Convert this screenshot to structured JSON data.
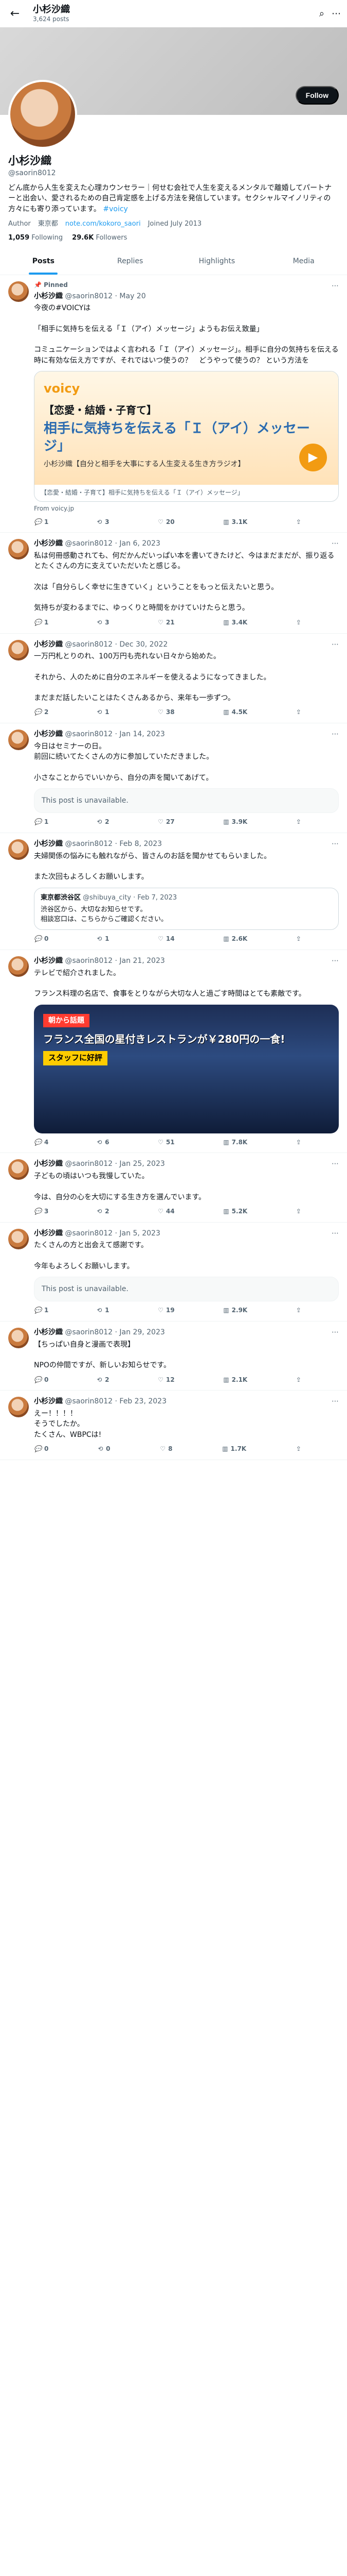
{
  "topbar": {
    "name": "小杉沙織",
    "count": "3,624 posts",
    "back_icon": "arrow-left-icon",
    "search_icon": "search-icon",
    "more_icon": "more-icon"
  },
  "profile": {
    "name": "小杉沙織",
    "handle": "@saorin8012",
    "follow_label": "Follow",
    "bio": "どん底から人生を変えた心理カウンセラー｜何せむ会社で人生を変えるメンタルで離婚してパートナーと出会い、愛されるための自己肯定感を上げる方法を発信しています。セクシャルマイノリティの方々にも寄り添っています。",
    "bio_tag": "#voicy",
    "location": "Author",
    "location2": "東京都",
    "website": "note.com/kokoro_saori",
    "joined": "Joined July 2013",
    "following_count": "1,059",
    "following_label": "Following",
    "followers_count": "29.6K",
    "followers_label": "Followers"
  },
  "tabs": [
    "Posts",
    "Replies",
    "Highlights",
    "Media"
  ],
  "tweets": [
    {
      "pinned": "Pinned",
      "name": "小杉沙織",
      "handle": "@saorin8012",
      "date": "May 20",
      "text": "今夜の#VOICYは\n\n「相手に気持ちを伝える「Ｉ（アイ）メッセージ」ようもお伝え致量」\n\nコミュニケーションではよく言われる「Ｉ（アイ）メッセージ」。相手に自分の気持ちを伝える時に有効な伝え方ですが、それではいつ使うの？　どうやって使うの？ という方法を",
      "card_voicy": "voicy",
      "card_t1": "【恋愛・結婚・子育て】",
      "card_t2": "相手に気持ちを伝える「Ｉ（アイ）メッセージ」",
      "card_t3": "小杉沙織【自分と相手を大事にする人生変える生き方ラジオ】",
      "card_caption": "【恋愛・結婚・子育て】相手に気持ちを伝える「Ｉ（アイ）メッセージ」",
      "from": "From voicy.jp",
      "replies": "1",
      "retweets": "3",
      "likes": "20",
      "views": "3.1K"
    },
    {
      "name": "小杉沙織",
      "handle": "@saorin8012",
      "date": "Jan 6, 2023",
      "text": "私は何冊感動されても、何だかんだいっぱい本を書いてきたけど、今はまだまだが、振り返るとたくさんの方に支えていただいたと感じる。\n\n次は「自分らしく幸せに生きていく」ということをもっと伝えたいと思う。\n\n気持ちが変わるまでに、ゆっくりと時間をかけていけたらと思う。",
      "replies": "1",
      "retweets": "3",
      "likes": "21",
      "views": "3.4K"
    },
    {
      "name": "小杉沙織",
      "handle": "@saorin8012",
      "date": "Dec 30, 2022",
      "text": "一万円札とりのれ、100万円も売れない日々から始めた。\n\nそれから、人のために自分のエネルギーを使えるようになってきました。\n\nまだまだ話したいことはたくさんあるから、来年も一歩ずつ。",
      "replies": "2",
      "retweets": "1",
      "likes": "38",
      "views": "4.5K"
    },
    {
      "name": "小杉沙織",
      "handle": "@saorin8012",
      "date": "Jan 14, 2023",
      "text": "今日はセミナーの日。\n前回に続いてたくさんの方に参加していただきました。\n\n小さなことからでいいから、自分の声を聞いてあげて。",
      "unavailable": "This post is unavailable.",
      "replies": "1",
      "retweets": "2",
      "likes": "27",
      "views": "3.9K"
    },
    {
      "name": "小杉沙織",
      "handle": "@saorin8012",
      "date": "Feb 8, 2023",
      "text": "夫婦関係の悩みにも触れながら、皆さんのお話を聞かせてもらいました。\n\nまた次回もよろしくお願いします。",
      "quote_name": "東京都渋谷区",
      "quote_handle": "@shibuya_city",
      "quote_date": "Feb 7, 2023",
      "quote_text": "渋谷区から、大切なお知らせです。\n相談窓口は、こちらからご確認ください。",
      "replies": "0",
      "retweets": "1",
      "likes": "14",
      "views": "2.6K"
    },
    {
      "name": "小杉沙織",
      "handle": "@saorin8012",
      "date": "Jan 21, 2023",
      "text": "テレビで紹介されました。\n\nフランス料理の名店で、食事をとりながら大切な人と過ごす時間はとても素敵です。",
      "photo_badge": "朝から話題",
      "photo_title": "フランス全国の星付きレストランが￥280円の一食!",
      "photo_sub": "スタッフに好評",
      "replies": "4",
      "retweets": "6",
      "likes": "51",
      "views": "7.8K"
    },
    {
      "name": "小杉沙織",
      "handle": "@saorin8012",
      "date": "Jan 25, 2023",
      "text": "子どもの頃はいつも我慢していた。\n\n今は、自分の心を大切にする生き方を選んでいます。",
      "replies": "3",
      "retweets": "2",
      "likes": "44",
      "views": "5.2K"
    },
    {
      "name": "小杉沙織",
      "handle": "@saorin8012",
      "date": "Jan 5, 2023",
      "text": "たくさんの方と出会えて感謝です。\n\n今年もよろしくお願いします。",
      "unavailable": "This post is unavailable.",
      "replies": "1",
      "retweets": "1",
      "likes": "19",
      "views": "2.9K"
    },
    {
      "name": "小杉沙織",
      "handle": "@saorin8012",
      "date": "Jan 29, 2023",
      "text": "【ちっぱい自身と漫画で表現】\n\nNPOの仲間ですが、新しいお知らせです。",
      "replies": "0",
      "retweets": "2",
      "likes": "12",
      "views": "2.1K"
    },
    {
      "name": "小杉沙織",
      "handle": "@saorin8012",
      "date": "Feb 23, 2023",
      "text": "えー！！！！\nそうでしたか。\nたくさん、WBPCは!",
      "replies": "0",
      "retweets": "0",
      "likes": "8",
      "views": "1.7K"
    }
  ],
  "icons": {
    "reply": "reply-icon",
    "retweet": "retweet-icon",
    "like": "heart-icon",
    "views": "chart-icon",
    "share": "share-icon",
    "more": "more-icon",
    "pin": "pin-icon"
  },
  "colors": {
    "accent": "#1d9bf0",
    "text": "#0f1419",
    "muted": "#536471"
  }
}
